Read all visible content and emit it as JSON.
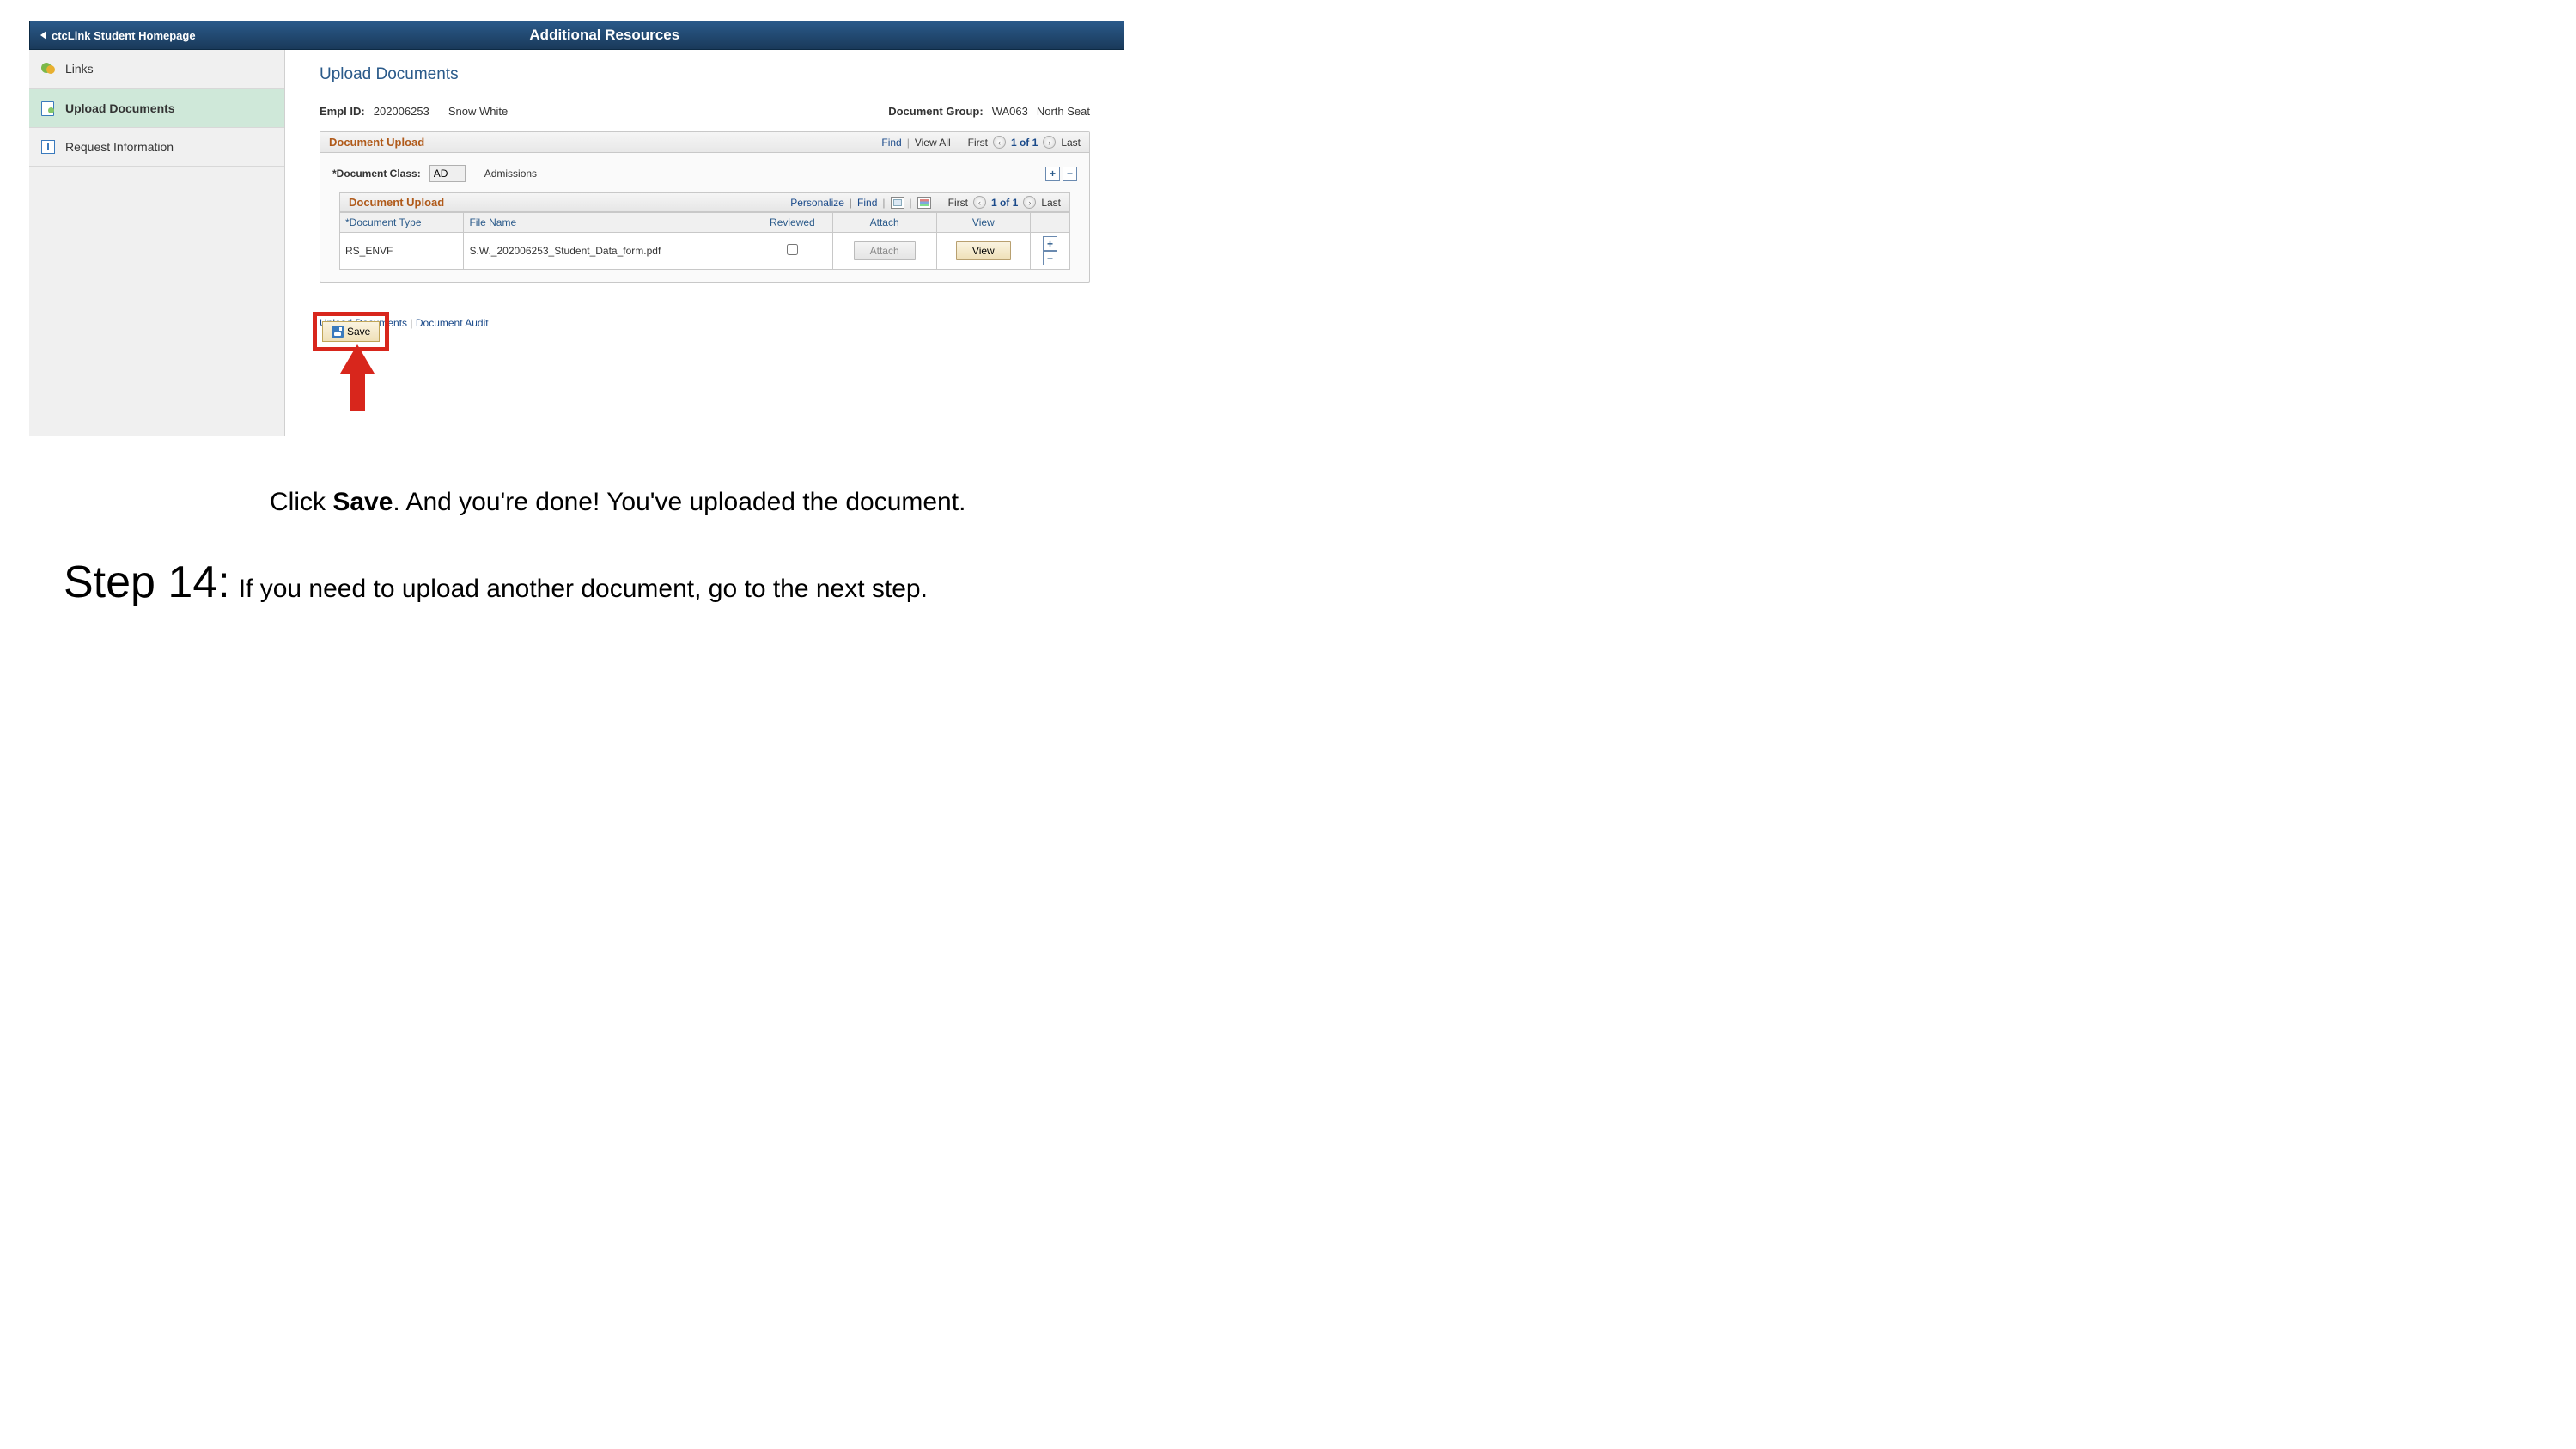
{
  "header": {
    "back_label": "ctcLink Student Homepage",
    "title": "Additional Resources"
  },
  "sidebar": {
    "items": [
      {
        "label": "Links"
      },
      {
        "label": "Upload Documents"
      },
      {
        "label": "Request Information"
      }
    ]
  },
  "page": {
    "title": "Upload Documents",
    "empl_id_label": "Empl ID:",
    "empl_id": "202006253",
    "empl_name": "Snow White",
    "doc_group_label": "Document Group:",
    "doc_group_code": "WA063",
    "doc_group_name": "North Seat"
  },
  "outer": {
    "title": "Document Upload",
    "find": "Find",
    "view_all": "View All",
    "first": "First",
    "count": "1 of 1",
    "last": "Last",
    "class_label": "*Document Class:",
    "class_value": "AD",
    "class_desc": "Admissions"
  },
  "inner": {
    "title": "Document Upload",
    "personalize": "Personalize",
    "find": "Find",
    "first": "First",
    "count": "1 of 1",
    "last": "Last",
    "headers": {
      "type": "*Document Type",
      "file": "File Name",
      "reviewed": "Reviewed",
      "attach": "Attach",
      "view": "View"
    },
    "row": {
      "type": "RS_ENVF",
      "file": "S.W._202006253_Student_Data_form.pdf",
      "attach_btn": "Attach",
      "view_btn": "View"
    }
  },
  "save": {
    "label": "Save"
  },
  "bottom_links": {
    "upload": "Upload Documents",
    "audit": "Document Audit"
  },
  "instructions": {
    "click": "Click ",
    "save_word": "Save",
    "rest1": ". And you're done!  You've uploaded the document.",
    "step_label": "Step 14:",
    "line2": "If you need to upload another document, go to the next step."
  }
}
